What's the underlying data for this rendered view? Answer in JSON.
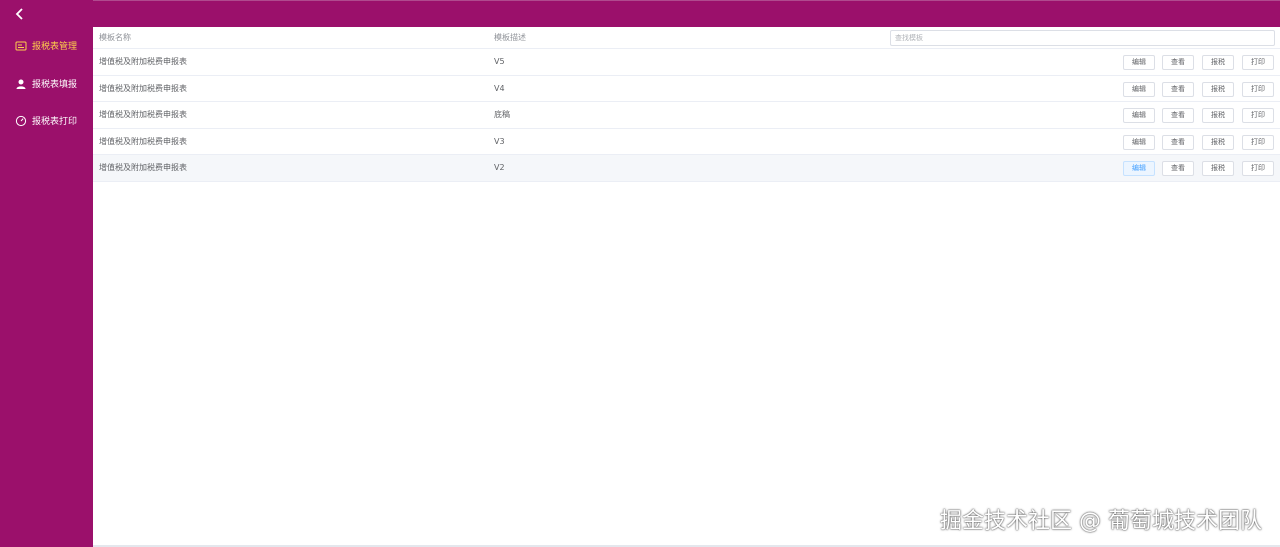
{
  "sidebar": {
    "collapse_icon": "chevron-left-icon",
    "items": [
      {
        "label": "报税表管理",
        "icon": "form-icon",
        "active": true
      },
      {
        "label": "报税表填报",
        "icon": "user-icon",
        "active": false
      },
      {
        "label": "报税表打印",
        "icon": "gauge-icon",
        "active": false
      }
    ]
  },
  "colors": {
    "brand": "#9b106b",
    "active_text": "#ffd04b",
    "focus_blue": "#409eff"
  },
  "table": {
    "headers": {
      "name": "模板名称",
      "desc": "模板描述"
    },
    "search_placeholder": "查找模板",
    "rows": [
      {
        "name": "增值税及附加税费申报表",
        "desc": "V5"
      },
      {
        "name": "增值税及附加税费申报表",
        "desc": "V4"
      },
      {
        "name": "增值税及附加税费申报表",
        "desc": "底稿"
      },
      {
        "name": "增值税及附加税费申报表",
        "desc": "V3"
      },
      {
        "name": "增值税及附加税费申报表",
        "desc": "V2"
      }
    ],
    "actions": {
      "edit": "编辑",
      "view": "查看",
      "file": "报税",
      "print": "打印"
    }
  },
  "watermark": "掘金技术社区 @ 葡萄城技术团队"
}
